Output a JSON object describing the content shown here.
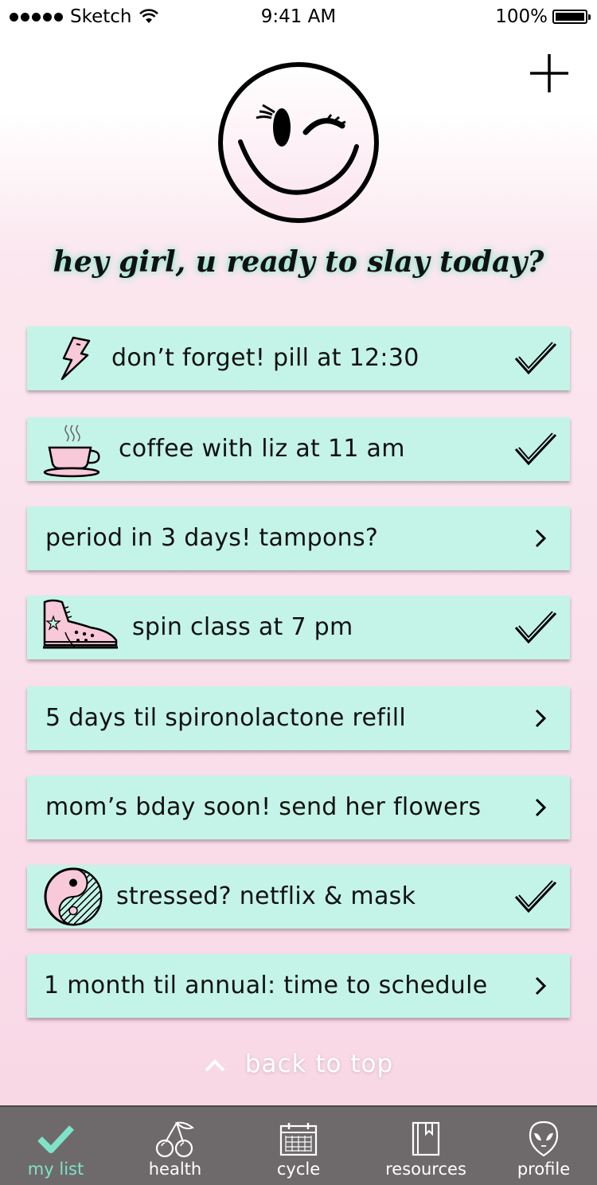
{
  "status_bar": {
    "carrier": "Sketch",
    "time": "9:41 AM",
    "battery": "100%"
  },
  "header": {
    "add_icon": "plus-icon",
    "mascot_icon": "winking-smiley-icon",
    "greeting": "hey girl, u ready to slay today?"
  },
  "reminders": [
    {
      "label": "don’t forget! pill at 12:30",
      "icon": "lightning-bolt-icon",
      "action": "checkmark"
    },
    {
      "label": "coffee with liz at 11 am",
      "icon": "coffee-cup-icon",
      "action": "checkmark"
    },
    {
      "label": "period in 3 days! tampons?",
      "icon": null,
      "action": "chevron"
    },
    {
      "label": "spin class at 7 pm",
      "icon": "sneaker-icon",
      "action": "checkmark"
    },
    {
      "label": "5 days til spironolactone refill",
      "icon": null,
      "action": "chevron"
    },
    {
      "label": "mom’s bday soon! send her flowers",
      "icon": null,
      "action": "chevron"
    },
    {
      "label": "stressed? netflix & mask",
      "icon": "yin-yang-icon",
      "action": "checkmark"
    },
    {
      "label": "1 month til annual: time to schedule",
      "icon": null,
      "action": "chevron"
    }
  ],
  "back_to_top": "back to top",
  "tabs": [
    {
      "label": "my list",
      "icon": "checkmark-icon",
      "active": true
    },
    {
      "label": "health",
      "icon": "cherries-icon",
      "active": false
    },
    {
      "label": "cycle",
      "icon": "calendar-icon",
      "active": false
    },
    {
      "label": "resources",
      "icon": "book-icon",
      "active": false
    },
    {
      "label": "profile",
      "icon": "alien-icon",
      "active": false
    }
  ],
  "colors": {
    "card_bg": "#c4f4e7",
    "accent_mint": "#7fe3c8",
    "pink_bg": "#f9d8e6",
    "tabbar_bg": "#6e6a6c",
    "icon_pink": "#f8c9d8"
  }
}
